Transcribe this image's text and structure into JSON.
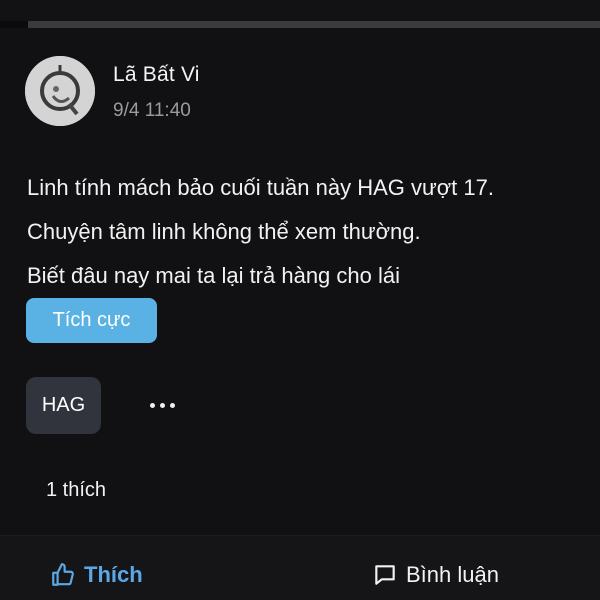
{
  "post": {
    "author_name": "Lã Bất Vi",
    "timestamp": "9/4 11:40",
    "body_lines": [
      "Linh tính mách bảo cuối tuần này HAG vượt 17.",
      "Chuyện tâm linh không thể xem thường.",
      "Biết đâu nay mai ta lại trả hàng cho lái"
    ],
    "sentiment_label": "Tích cực",
    "ticker_tag": "HAG",
    "like_count_text": "1 thích"
  },
  "actions": {
    "like_label": "Thích",
    "comment_label": "Bình luận"
  },
  "colors": {
    "accent_blue": "#5aa9e6",
    "badge_blue": "#5ab2e4",
    "chip_bg": "#31343c",
    "background": "#111113"
  },
  "icons": {
    "like": "thumbs-up-icon",
    "comment": "comment-icon",
    "more": "more-dots-icon"
  }
}
